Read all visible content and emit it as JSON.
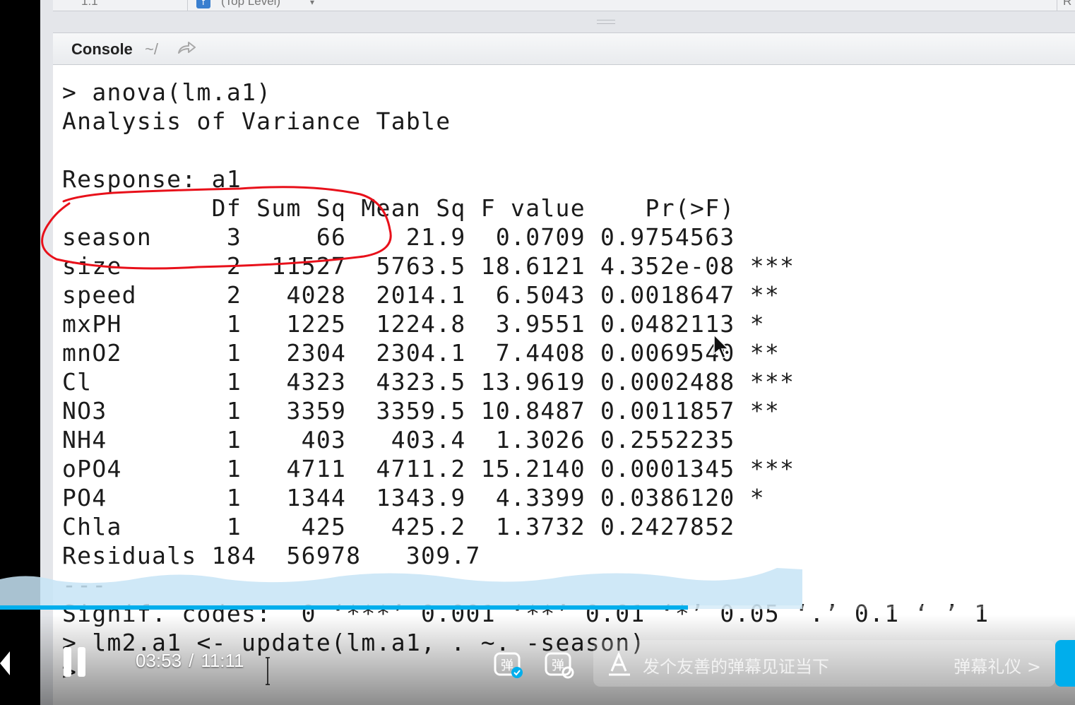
{
  "editor_status": {
    "position": "1:1",
    "scope": "(Top Level)",
    "right_label": "R"
  },
  "console": {
    "title": "Console",
    "path": "~/",
    "lines": [
      {
        "text": "> anova(lm.a1)",
        "kind": "command"
      },
      {
        "text": "Analysis of Variance Table",
        "kind": "output"
      },
      {
        "text": "",
        "kind": "output"
      },
      {
        "text": "Response: a1",
        "kind": "output"
      },
      {
        "text": "          Df Sum Sq Mean Sq F value    Pr(>F)    ",
        "kind": "output"
      },
      {
        "text": "season     3     66    21.9  0.0709 0.9754563    ",
        "kind": "output"
      },
      {
        "text": "size       2  11527  5763.5 18.6121 4.352e-08 ***",
        "kind": "output"
      },
      {
        "text": "speed      2   4028  2014.1  6.5043 0.0018647 ** ",
        "kind": "output"
      },
      {
        "text": "mxPH       1   1225  1224.8  3.9551 0.0482113 *  ",
        "kind": "output"
      },
      {
        "text": "mnO2       1   2304  2304.1  7.4408 0.0069540 ** ",
        "kind": "output"
      },
      {
        "text": "Cl         1   4323  4323.5 13.9619 0.0002488 ***",
        "kind": "output"
      },
      {
        "text": "NO3        1   3359  3359.5 10.8487 0.0011857 ** ",
        "kind": "output"
      },
      {
        "text": "NH4        1    403   403.4  1.3026 0.2552235    ",
        "kind": "output"
      },
      {
        "text": "oPO4       1   4711  4711.2 15.2140 0.0001345 ***",
        "kind": "output"
      },
      {
        "text": "PO4        1   1344  1343.9  4.3399 0.0386120 *  ",
        "kind": "output"
      },
      {
        "text": "Chla       1    425   425.2  1.3732 0.2427852    ",
        "kind": "output"
      },
      {
        "text": "Residuals 184  56978   309.7                      ",
        "kind": "output"
      },
      {
        "text": "---",
        "kind": "output"
      },
      {
        "text": "Signif. codes:  0 ‘***’ 0.001 ‘**’ 0.01 ‘*’ 0.05 ‘.’ 0.1 ‘ ’ 1",
        "kind": "output"
      },
      {
        "text": "> lm2.a1 <- update(lm.a1, . ~. -season)",
        "kind": "command"
      },
      {
        "text": "> ",
        "kind": "command"
      }
    ]
  },
  "player": {
    "current_time": "03:53",
    "duration": "11:11",
    "progress_fraction": 0.64,
    "danmaku_placeholder": "发个友善的弹幕见证当下",
    "danmaku_etiquette": "弹幕礼仪 >",
    "accent_color": "#00aeec"
  },
  "annotation_color": "#e8101a"
}
